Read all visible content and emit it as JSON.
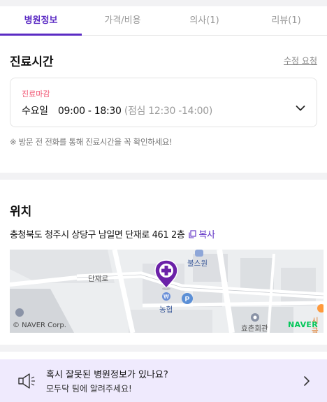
{
  "tabs": [
    {
      "label": "병원정보",
      "active": true
    },
    {
      "label": "가격/비용",
      "active": false
    },
    {
      "label": "의사(1)",
      "active": false
    },
    {
      "label": "리뷰(1)",
      "active": false
    }
  ],
  "hours": {
    "title": "진료시간",
    "edit_label": "수정 요청",
    "status_badge": "진료마감",
    "day": "수요일",
    "time": "09:00 - 18:30",
    "lunch": "(점심 12:30 -14:00)",
    "notice": "※ 방문 전 전화를 통해 진료시간을 꼭 확인하세요!"
  },
  "location": {
    "title": "위치",
    "address": "충청북도 청주시 상당구 남일면 단재로 461 2층",
    "copy_label": "복사"
  },
  "map": {
    "labels": {
      "road": "단재로",
      "bullsone": "불스원",
      "bank": "농협",
      "hall": "효촌회관",
      "side_partial": "시글",
      "left_partial": "농협"
    },
    "copyright": "© NAVER Corp.",
    "brand": "NAVER",
    "pin_color": "#6b21a8",
    "brand_color": "#03c75a"
  },
  "banner": {
    "line1": "혹시 잘못된 병원정보가 있나요?",
    "line2": "모두닥 팀에 알려주세요!"
  },
  "colors": {
    "accent": "#5b2bc4",
    "closed": "#f0506e",
    "banner_bg": "#efeafd"
  }
}
